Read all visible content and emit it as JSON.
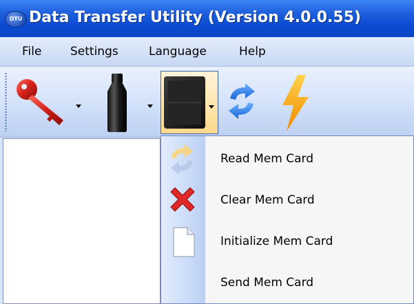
{
  "window": {
    "title": "Data Transfer Utility (Version 4.0.0.55)",
    "icon_text": "DTU"
  },
  "menubar": {
    "items": [
      {
        "label": "File"
      },
      {
        "label": "Settings"
      },
      {
        "label": "Language"
      },
      {
        "label": "Help"
      }
    ]
  },
  "toolbar": {
    "buttons": [
      {
        "icon": "key-icon",
        "has_dropdown": true
      },
      {
        "icon": "bottle-device-icon",
        "has_dropdown": true
      },
      {
        "icon": "memory-card-icon",
        "has_dropdown": true,
        "active": true
      },
      {
        "icon": "refresh-icon",
        "has_dropdown": false
      },
      {
        "icon": "lightning-icon",
        "has_dropdown": false
      }
    ]
  },
  "dropdown": {
    "items": [
      {
        "label": "Read Mem Card",
        "icon": "refresh-faded-icon"
      },
      {
        "label": "Clear Mem Card",
        "icon": "red-x-icon"
      },
      {
        "label": "Initialize Mem Card",
        "icon": "blank-page-icon"
      },
      {
        "label": "Send Mem Card",
        "icon": ""
      }
    ]
  },
  "colors": {
    "titlebar": "#0a4bd2",
    "menubar": "#d6e3f8",
    "dropdown_border": "#6f89c0"
  }
}
